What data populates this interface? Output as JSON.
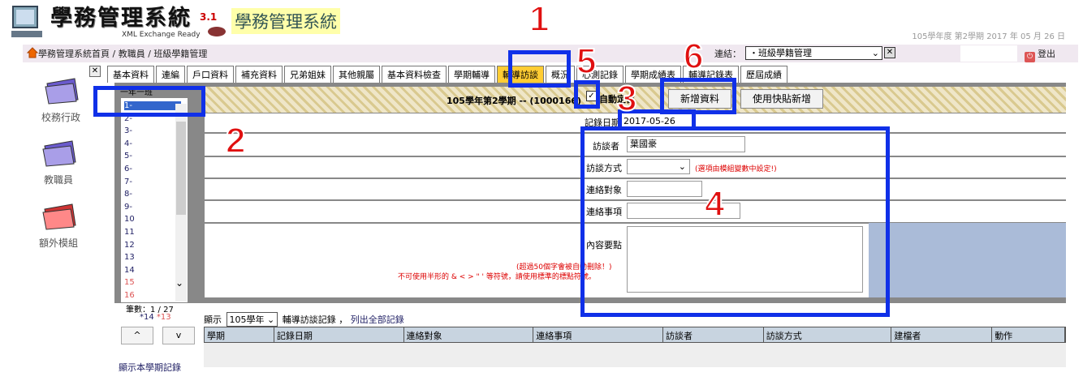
{
  "header": {
    "logo_text": "學務管理系統",
    "logo_version": "3.1",
    "logo_sub": "XML Exchange Ready",
    "system_title": "學務管理系統",
    "term": "105學年度 第2學期 2017 年 05 月 26 日"
  },
  "nav": {
    "breadcrumb": "學務管理系統首頁 / 教職員 / 班級學籍管理",
    "link_label": "連結：",
    "link_select": "・班級學籍管理",
    "logout": "登出"
  },
  "sidebar": {
    "items": [
      {
        "label": "校務行政",
        "icon": "folder-purple-icon"
      },
      {
        "label": "教職員",
        "icon": "folder-purple-icon"
      },
      {
        "label": "額外模組",
        "icon": "folder-red-icon"
      }
    ]
  },
  "tabs": [
    {
      "label": "基本資料"
    },
    {
      "label": "連編"
    },
    {
      "label": "戶口資料"
    },
    {
      "label": "補充資料"
    },
    {
      "label": "兄弟姐妹"
    },
    {
      "label": "其他親屬"
    },
    {
      "label": "基本資料檢查"
    },
    {
      "label": "學期輔導"
    },
    {
      "label": "輔導訪談",
      "active": true
    },
    {
      "label": "概況"
    },
    {
      "label": "心測記錄"
    },
    {
      "label": "學期成績表"
    },
    {
      "label": "輔導記錄表"
    },
    {
      "label": "歷屆成績"
    }
  ],
  "class_list": {
    "header": "一年一班",
    "items": [
      "1-",
      "2-",
      "3-",
      "4-",
      "5-",
      "6-",
      "7-",
      "8-",
      "9-",
      "10",
      "11",
      "12",
      "13",
      "14",
      "15",
      "16"
    ],
    "red_items": [
      "15",
      "16"
    ],
    "count_label": "筆數：1 / 27",
    "count_marks": [
      "*14",
      "*13"
    ],
    "up_button": "^",
    "down_button": "v",
    "show_semester": "顯示本學期記錄"
  },
  "form": {
    "title": "105學年第2學期 -- (1000166)",
    "auto_position_label": "自動定位",
    "auto_position_checked": true,
    "add_button": "新增資料",
    "paste_button": "使用快貼新增",
    "record_date_label": "記錄日期",
    "record_date": "2017-05-26",
    "interviewer_label": "訪談者",
    "interviewer": "葉國豪",
    "method_label": "訪談方式",
    "method_value": "",
    "method_note": "(選項由模組變數中設定!)",
    "contact_target_label": "連絡對象",
    "contact_target": "",
    "contact_item_label": "連絡事項",
    "contact_item": "",
    "content_label": "內容要點",
    "content": "",
    "note1": "(超過50個字會被自動刪除！)",
    "note2": "不可使用半形的 & < > \" ' 等符號，請使用標準的標點符號。"
  },
  "records": {
    "show_label": "顯示",
    "year_select": "105學年",
    "text": "輔導訪談記錄 ，",
    "list_all": "列出全部記錄",
    "columns": [
      "學期",
      "記錄日期",
      "連絡對象",
      "連絡事項",
      "訪談者",
      "訪談方式",
      "建檔者",
      "動作"
    ]
  },
  "annotations": [
    "1",
    "2",
    "3",
    "4",
    "5",
    "6"
  ],
  "colors": {
    "annotation_box": "#1030e8",
    "annotation_number": "#e01010",
    "active_tab": "#ffcc33"
  }
}
